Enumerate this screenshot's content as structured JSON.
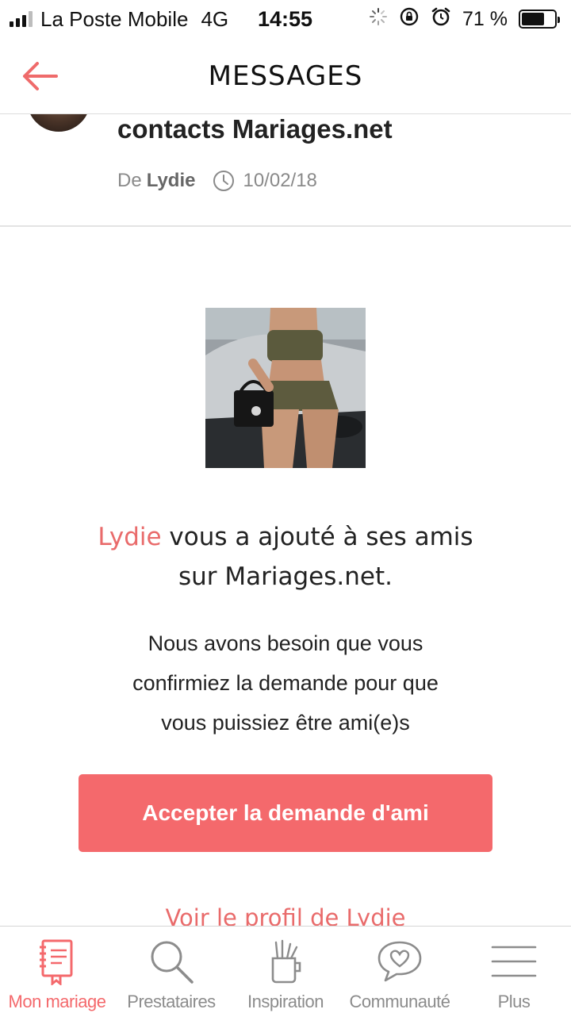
{
  "status_bar": {
    "carrier": "La Poste Mobile",
    "network": "4G",
    "time": "14:55",
    "battery": "71 %",
    "battery_level": 0.71,
    "signal_bars": 4,
    "signal_bars_active": 3
  },
  "header": {
    "title": "MESSAGES",
    "back_icon": "arrow-left-icon"
  },
  "message": {
    "title": "contacts Mariages.net",
    "from_prefix": "De",
    "from_name": "Lydie",
    "date": "10/02/18"
  },
  "friend_request": {
    "sender_name": "Lydie",
    "added_text_1": " vous a ajouté à ses amis",
    "added_text_2": "sur Mariages.net.",
    "info_line_1": "Nous avons besoin que vous",
    "info_line_2": "confirmiez la demande pour que",
    "info_line_3": "vous puissiez être ami(e)s",
    "accept_button": "Accepter la demande d'ami",
    "profile_link": "Voir le profil de Lydie"
  },
  "bottom_nav": {
    "items": [
      {
        "label": "Mon mariage",
        "icon": "notebook-icon",
        "active": true
      },
      {
        "label": "Prestataires",
        "icon": "search-icon",
        "active": false
      },
      {
        "label": "Inspiration",
        "icon": "inspiration-cup-icon",
        "active": false
      },
      {
        "label": "Communauté",
        "icon": "heart-bubble-icon",
        "active": false
      },
      {
        "label": "Plus",
        "icon": "menu-icon",
        "active": false
      }
    ]
  },
  "colors": {
    "accent": "#f4696c",
    "link": "#e96b6b",
    "muted": "#8c8c8c"
  }
}
